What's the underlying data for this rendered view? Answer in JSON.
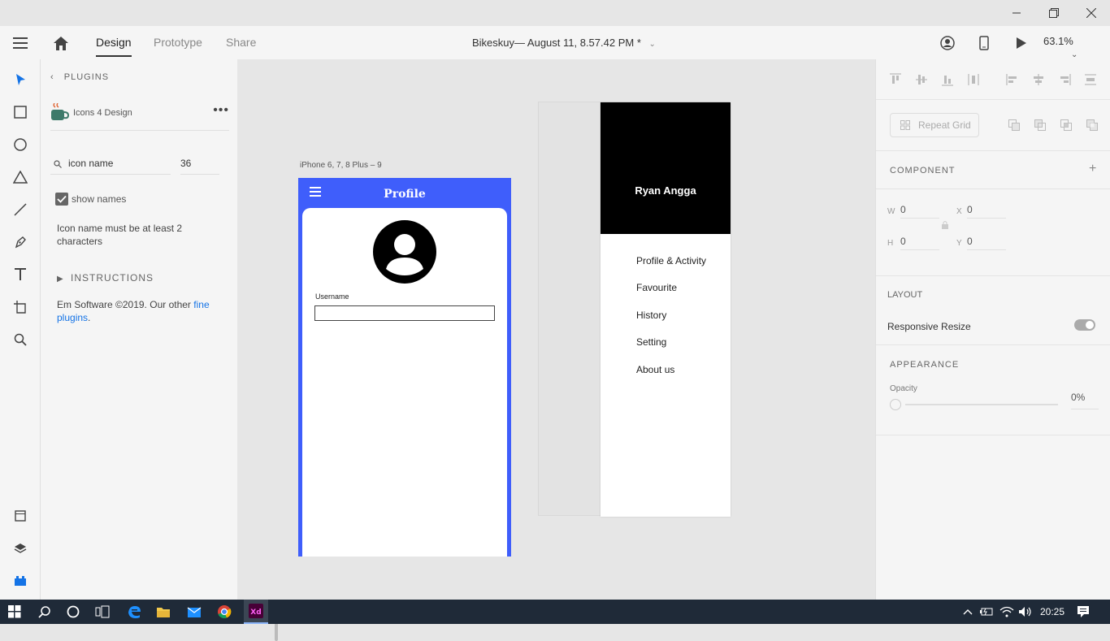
{
  "window": {
    "minimize_icon": "minimize-icon",
    "restore_icon": "restore-icon",
    "close_icon": "close-icon"
  },
  "appbar": {
    "tabs": [
      "Design",
      "Prototype",
      "Share"
    ],
    "active_tab": "Design",
    "doc_title": "Bikeskuy— August 11, 8.57.42 PM *",
    "zoom": "63.1%"
  },
  "plugins": {
    "back_label": "PLUGINS",
    "plugin_name": "Icons 4 Design",
    "search_placeholder": "icon name",
    "size_value": "36",
    "show_names_label": "show names",
    "show_names_checked": true,
    "hint": "Icon name must be at least 2 characters",
    "instructions_label": "INSTRUCTIONS",
    "credits_prefix": "Em Software ©2019. Our other ",
    "credits_link": "fine plugins",
    "credits_suffix": "."
  },
  "canvas": {
    "artboard1_label": "iPhone 6, 7, 8 Plus – 9",
    "artboard1": {
      "title": "Profile",
      "username_label": "Username",
      "accent_color": "#3f5efb"
    },
    "artboard2": {
      "name": "Ryan Angga",
      "menu_items": [
        "Profile & Activity",
        "Favourite",
        "History",
        "Setting",
        "About us"
      ]
    }
  },
  "inspector": {
    "repeat_grid_label": "Repeat Grid",
    "component_label": "COMPONENT",
    "w_label": "W",
    "w_value": "0",
    "h_label": "H",
    "h_value": "0",
    "x_label": "X",
    "x_value": "0",
    "y_label": "Y",
    "y_value": "0",
    "layout_label": "LAYOUT",
    "responsive_resize_label": "Responsive Resize",
    "appearance_label": "APPEARANCE",
    "opacity_label": "Opacity",
    "opacity_value": "0%"
  },
  "taskbar": {
    "time": "20:25"
  }
}
